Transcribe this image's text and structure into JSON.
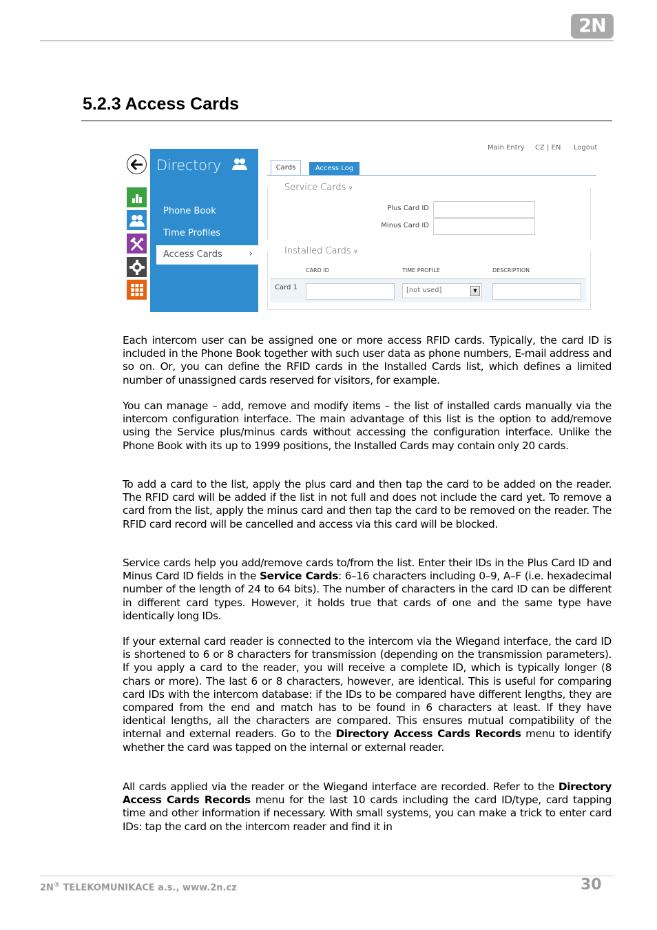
{
  "header": {
    "logo_text": "2N"
  },
  "section": {
    "title": "5.2.3 Access Cards"
  },
  "ui_screenshot": {
    "back_icon": "arrow-left-icon",
    "nav_tiles": [
      {
        "icon": "bar-chart-icon",
        "color": "#3aa23e"
      },
      {
        "icon": "users-icon",
        "color": "#2f8dcf"
      },
      {
        "icon": "tools-icon",
        "color": "#8a3fa0"
      },
      {
        "icon": "gear-icon",
        "color": "#474747"
      },
      {
        "icon": "grid-icon",
        "color": "#e8620e"
      }
    ],
    "panel": {
      "title": "Directory",
      "color": "#2f8dcf",
      "items": [
        {
          "label": "Phone Book"
        },
        {
          "label": "Time Profiles"
        },
        {
          "label": "Access Cards",
          "active": true,
          "chevron": "›"
        }
      ]
    },
    "top_links": {
      "main_entry": "Main Entry",
      "lang": "CZ | EN",
      "logout": "Logout"
    },
    "tabs": [
      {
        "label": "Cards",
        "active": true
      },
      {
        "label": "Access Log",
        "active": false
      }
    ],
    "service_cards": {
      "title": "Service Cards",
      "caret": "˅",
      "plus_label": "Plus Card ID",
      "plus_value": "",
      "minus_label": "Minus Card ID",
      "minus_value": ""
    },
    "installed_cards": {
      "title": "Installed Cards",
      "caret": "˅",
      "columns": [
        "CARD ID",
        "TIME PROFILE",
        "DESCRIPTION"
      ],
      "rows": [
        {
          "label": "Card 1",
          "card_id": "",
          "time_profile": "[not used]",
          "description": ""
        }
      ],
      "select_arrow": "▼"
    }
  },
  "paragraphs": {
    "p1": "Each intercom user can be assigned one or more access RFID cards. Typically, the card ID is included in the Phone Book together with such user data as phone numbers, E-mail address and so on. Or, you can define the RFID cards in the Installed Cards list, which defines a limited number of unassigned cards reserved for visitors, for example.",
    "p2": "You can manage – add, remove and modify items – the list of installed cards manually via the intercom configuration interface. The main advantage of this list is the option to add/remove using the Service plus/minus cards without accessing the configuration interface. Unlike the Phone Book with its up to 1999 positions, the Installed Cards may contain only 20 cards.",
    "p3": "To add a card to the list, apply the plus card and then tap the card to be added on the reader. The RFID card will be added if the list in not full and does not include the card yet. To remove a card from the list, apply the minus card and then tap the card to be removed on the reader. The RFID card record will be cancelled and access via this card will be blocked.",
    "p4_a": "Service cards help you add/remove cards to/from the list. Enter their IDs in the Plus Card ID and Minus Card ID fields in the ",
    "p4_bold": "Service Cards",
    "p4_b": ": 6–16 characters including 0–9, A–F (i.e. hexadecimal number of the length of 24 to 64 bits). The number of characters in the card ID can be different in different card types. However, it holds true that cards of one and the same type have identically long IDs.",
    "p5_a": "If your external card reader is connected to the intercom via the Wiegand interface, the card ID is shortened to 6 or 8 characters for transmission (depending on the transmission parameters). If you apply a card to the reader, you will receive a complete ID, which is typically longer (8 chars or more). The last 6 or 8 characters, however, are identical. This is useful for comparing card IDs with the intercom database: if the IDs to be compared have different lengths, they are compared from the end and match has to be found in 6 characters at least. If they have identical lengths, all the characters are compared. This ensures mutual compatibility of the internal and external readers. Go to the ",
    "p5_bold": "Directory  Access Cards  Records",
    "p5_b": " menu to identify whether the card was tapped on the internal or external reader.",
    "p6_a": "All cards applied via the reader or the Wiegand interface are recorded. Refer to the ",
    "p6_bold": "Directory  Access Cards  Records",
    "p6_b": "  menu for the last 10 cards including the card ID/type, card tapping time and other information if necessary. With small systems, you can make a trick to enter card IDs: tap the card on the intercom reader and find it in"
  },
  "footer": {
    "company_prefix": "2N",
    "registered": "®",
    "company_rest": " TELEKOMUNIKACE a.s., www.2n.cz",
    "page_number": "30"
  }
}
